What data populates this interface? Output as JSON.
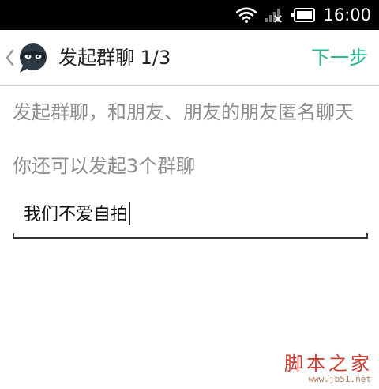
{
  "status_bar": {
    "time": "16:00",
    "icons": [
      "wifi-icon",
      "signal-icon",
      "battery-icon"
    ]
  },
  "header": {
    "back_icon": "chevron-left-icon",
    "logo_icon": "masked-chat-logo",
    "title": "发起群聊 1/3",
    "next_label": "下一步"
  },
  "body": {
    "description": "发起群聊，和朋友、朋友的朋友匿名聊天",
    "quota": "你还可以发起3个群聊",
    "group_name_input": {
      "value": "我们不爱自拍"
    }
  },
  "watermark": {
    "text": "脚本之家",
    "url": "www.jb51.net"
  },
  "colors": {
    "accent": "#27b68f",
    "status_bar": "#000000",
    "muted_text": "#8c8c8c",
    "watermark": "#d23c32"
  }
}
